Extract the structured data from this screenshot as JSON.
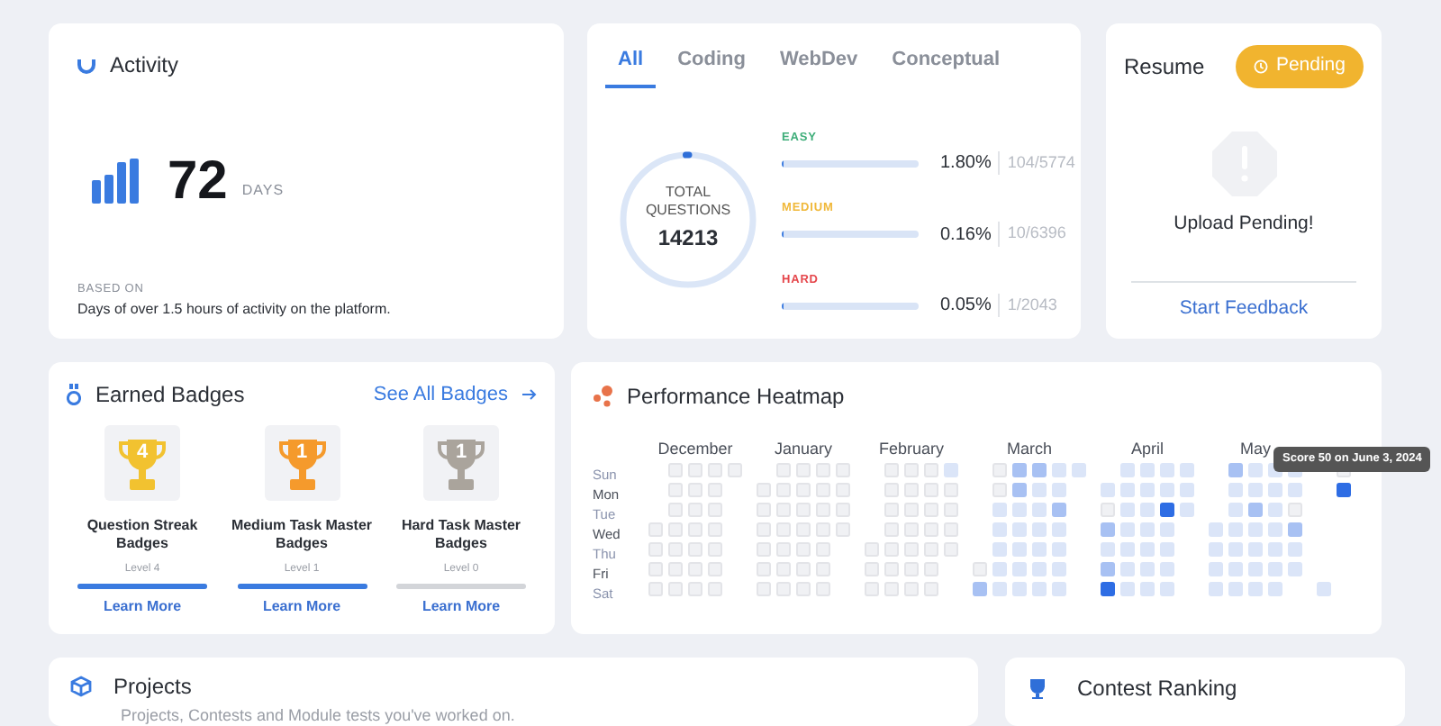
{
  "activity": {
    "title": "Activity",
    "value": "72",
    "unit": "DAYS",
    "note_label": "BASED ON",
    "note": "Days of over 1.5 hours of activity on the platform."
  },
  "questions": {
    "tabs": [
      {
        "label": "All",
        "selected": true
      },
      {
        "label": "Coding",
        "selected": false
      },
      {
        "label": "WebDev",
        "selected": false
      },
      {
        "label": "Conceptual",
        "selected": false
      }
    ],
    "total_label": "TOTAL QUESTIONS",
    "total": "14213",
    "level": 0.008,
    "difficulties": [
      {
        "label": "EASY",
        "color": "#3fae7a",
        "level": 0.018,
        "percent": "1.80%",
        "count": "104/5774"
      },
      {
        "label": "MEDIUM",
        "color": "#f0b83a",
        "level": 0.0016,
        "percent": "0.16%",
        "count": "10/6396"
      },
      {
        "label": "HARD",
        "color": "#e5484d",
        "level": 0.0005,
        "percent": "0.05%",
        "count": "1/2043"
      }
    ]
  },
  "resume": {
    "title": "Resume",
    "status": "Pending",
    "message": "Upload Pending!",
    "link": "Start Feedback"
  },
  "badges": {
    "title": "Earned Badges",
    "link": "See All Badges",
    "items": [
      {
        "number": "4",
        "color": "#f2c230",
        "name": "Question Streak Badges",
        "level_text": "Level 4",
        "level": 1,
        "link": "Learn More"
      },
      {
        "number": "1",
        "color": "#f59a2c",
        "name": "Medium Task Master Badges",
        "level_text": "Level 1",
        "level": 1,
        "link": "Learn More"
      },
      {
        "number": "1",
        "color": "#aaa49c",
        "name": "Hard Task Master Badges",
        "level_text": "Level 0",
        "level": 0,
        "link": "Learn More"
      }
    ]
  },
  "heatmap": {
    "title": "Performance Heatmap",
    "days": [
      "Sun",
      "Mon",
      "Tue",
      "Wed",
      "Thu",
      "Fri",
      "Sat"
    ],
    "tooltip": "Score 50 on June 3, 2024",
    "months": [
      {
        "name": "December",
        "weeks": [
          {
            "wed": {
              "color": "#f0f1f4"
            },
            "thu": {
              "color": "#f0f1f4"
            },
            "fri": {
              "color": "#f0f1f4"
            },
            "sat": {
              "color": "#f0f1f4"
            }
          },
          {
            "sun": {
              "color": "#f0f1f4"
            },
            "mon": {
              "color": "#f0f1f4"
            },
            "tue": {
              "color": "#f0f1f4"
            },
            "wed": {
              "color": "#f0f1f4"
            },
            "thu": {
              "color": "#f0f1f4"
            },
            "fri": {
              "color": "#f0f1f4"
            },
            "sat": {
              "color": "#f0f1f4"
            }
          },
          {
            "sun": {
              "color": "#f0f1f4"
            },
            "mon": {
              "color": "#f0f1f4"
            },
            "tue": {
              "color": "#f0f1f4"
            },
            "wed": {
              "color": "#f0f1f4"
            },
            "thu": {
              "color": "#f0f1f4"
            },
            "fri": {
              "color": "#f0f1f4"
            },
            "sat": {
              "color": "#f0f1f4"
            }
          },
          {
            "sun": {
              "color": "#f0f1f4"
            },
            "mon": {
              "color": "#f0f1f4"
            },
            "tue": {
              "color": "#f0f1f4"
            },
            "wed": {
              "color": "#f0f1f4"
            },
            "thu": {
              "color": "#f0f1f4"
            },
            "fri": {
              "color": "#f0f1f4"
            },
            "sat": {
              "color": "#f0f1f4"
            }
          },
          {
            "sun": {
              "color": "#f0f1f4"
            }
          }
        ]
      },
      {
        "name": "January",
        "weeks": [
          {
            "mon": {
              "color": "#f0f1f4"
            },
            "tue": {
              "color": "#f0f1f4"
            },
            "wed": {
              "color": "#f0f1f4"
            },
            "thu": {
              "color": "#f0f1f4"
            },
            "fri": {
              "color": "#f0f1f4"
            },
            "sat": {
              "color": "#f0f1f4"
            }
          },
          {
            "sun": {
              "color": "#f0f1f4"
            },
            "mon": {
              "color": "#f0f1f4"
            },
            "tue": {
              "color": "#f0f1f4"
            },
            "wed": {
              "color": "#f0f1f4"
            },
            "thu": {
              "color": "#f0f1f4"
            },
            "fri": {
              "color": "#f0f1f4"
            },
            "sat": {
              "color": "#f0f1f4"
            }
          },
          {
            "sun": {
              "color": "#f0f1f4"
            },
            "mon": {
              "color": "#f0f1f4"
            },
            "tue": {
              "color": "#f0f1f4"
            },
            "wed": {
              "color": "#f0f1f4"
            },
            "thu": {
              "color": "#f0f1f4"
            },
            "fri": {
              "color": "#f0f1f4"
            },
            "sat": {
              "color": "#f0f1f4"
            }
          },
          {
            "sun": {
              "color": "#f0f1f4"
            },
            "mon": {
              "color": "#f0f1f4"
            },
            "tue": {
              "color": "#f0f1f4"
            },
            "wed": {
              "color": "#f0f1f4"
            },
            "thu": {
              "color": "#f0f1f4"
            },
            "fri": {
              "color": "#f0f1f4"
            },
            "sat": {
              "color": "#f0f1f4"
            }
          },
          {
            "sun": {
              "color": "#f0f1f4"
            },
            "mon": {
              "color": "#f0f1f4"
            },
            "tue": {
              "color": "#f0f1f4"
            },
            "wed": {
              "color": "#f0f1f4"
            }
          }
        ]
      },
      {
        "name": "February",
        "weeks": [
          {
            "thu": {
              "color": "#f0f1f4"
            },
            "fri": {
              "color": "#f0f1f4"
            },
            "sat": {
              "color": "#f0f1f4"
            }
          },
          {
            "sun": {
              "color": "#f0f1f4"
            },
            "mon": {
              "color": "#f0f1f4"
            },
            "tue": {
              "color": "#f0f1f4"
            },
            "wed": {
              "color": "#f0f1f4"
            },
            "thu": {
              "color": "#f0f1f4"
            },
            "fri": {
              "color": "#f0f1f4"
            },
            "sat": {
              "color": "#f0f1f4"
            }
          },
          {
            "sun": {
              "color": "#f0f1f4"
            },
            "mon": {
              "color": "#f0f1f4"
            },
            "tue": {
              "color": "#f0f1f4"
            },
            "wed": {
              "color": "#f0f1f4"
            },
            "thu": {
              "color": "#f0f1f4"
            },
            "fri": {
              "color": "#f0f1f4"
            },
            "sat": {
              "color": "#f0f1f4"
            }
          },
          {
            "sun": {
              "color": "#f0f1f4"
            },
            "mon": {
              "color": "#f0f1f4"
            },
            "tue": {
              "color": "#f0f1f4"
            },
            "wed": {
              "color": "#f0f1f4"
            },
            "thu": {
              "color": "#f0f1f4"
            },
            "fri": {
              "color": "#f0f1f4"
            },
            "sat": {
              "color": "#f0f1f4"
            }
          },
          {
            "sun": {
              "color": "#dbe5f8"
            },
            "mon": {
              "color": "#f0f1f4"
            },
            "tue": {
              "color": "#f0f1f4"
            },
            "wed": {
              "color": "#f0f1f4"
            },
            "thu": {
              "color": "#f0f1f4"
            }
          }
        ]
      },
      {
        "name": "March",
        "weeks": [
          {
            "fri": {
              "color": "#f0f1f4"
            },
            "sat": {
              "color": "#a8c1f3"
            }
          },
          {
            "sun": {
              "color": "#f0f1f4"
            },
            "mon": {
              "color": "#f0f1f4"
            },
            "tue": {
              "color": "#dbe5f8"
            },
            "wed": {
              "color": "#dbe5f8"
            },
            "thu": {
              "color": "#dbe5f8"
            },
            "fri": {
              "color": "#dbe5f8"
            },
            "sat": {
              "color": "#dbe5f8"
            }
          },
          {
            "sun": {
              "color": "#a8c1f3"
            },
            "mon": {
              "color": "#a8c1f3"
            },
            "tue": {
              "color": "#dbe5f8"
            },
            "wed": {
              "color": "#dbe5f8"
            },
            "thu": {
              "color": "#dbe5f8"
            },
            "fri": {
              "color": "#dbe5f8"
            },
            "sat": {
              "color": "#dbe5f8"
            }
          },
          {
            "sun": {
              "color": "#a8c1f3"
            },
            "mon": {
              "color": "#dbe5f8"
            },
            "tue": {
              "color": "#dbe5f8"
            },
            "wed": {
              "color": "#dbe5f8"
            },
            "thu": {
              "color": "#dbe5f8"
            },
            "fri": {
              "color": "#dbe5f8"
            },
            "sat": {
              "color": "#dbe5f8"
            }
          },
          {
            "sun": {
              "color": "#dbe5f8"
            },
            "mon": {
              "color": "#dbe5f8"
            },
            "tue": {
              "color": "#a8c1f3"
            },
            "wed": {
              "color": "#dbe5f8"
            },
            "thu": {
              "color": "#dbe5f8"
            },
            "fri": {
              "color": "#dbe5f8"
            },
            "sat": {
              "color": "#dbe5f8"
            }
          },
          {
            "sun": {
              "color": "#dbe5f8"
            }
          }
        ]
      },
      {
        "name": "April",
        "weeks": [
          {
            "mon": {
              "color": "#dbe5f8"
            },
            "tue": {
              "color": "#f0f1f4"
            },
            "wed": {
              "color": "#a8c1f3"
            },
            "thu": {
              "color": "#dbe5f8"
            },
            "fri": {
              "color": "#a8c1f3"
            },
            "sat": {
              "color": "#2e6de4"
            }
          },
          {
            "sun": {
              "color": "#dbe5f8"
            },
            "mon": {
              "color": "#dbe5f8"
            },
            "tue": {
              "color": "#dbe5f8"
            },
            "wed": {
              "color": "#dbe5f8"
            },
            "thu": {
              "color": "#dbe5f8"
            },
            "fri": {
              "color": "#dbe5f8"
            },
            "sat": {
              "color": "#dbe5f8"
            }
          },
          {
            "sun": {
              "color": "#dbe5f8"
            },
            "mon": {
              "color": "#dbe5f8"
            },
            "tue": {
              "color": "#dbe5f8"
            },
            "wed": {
              "color": "#dbe5f8"
            },
            "thu": {
              "color": "#dbe5f8"
            },
            "fri": {
              "color": "#dbe5f8"
            },
            "sat": {
              "color": "#dbe5f8"
            }
          },
          {
            "sun": {
              "color": "#dbe5f8"
            },
            "mon": {
              "color": "#dbe5f8"
            },
            "tue": {
              "color": "#2e6de4"
            },
            "wed": {
              "color": "#dbe5f8"
            },
            "thu": {
              "color": "#dbe5f8"
            },
            "fri": {
              "color": "#dbe5f8"
            },
            "sat": {
              "color": "#dbe5f8"
            }
          },
          {
            "sun": {
              "color": "#dbe5f8"
            },
            "mon": {
              "color": "#dbe5f8"
            },
            "tue": {
              "color": "#dbe5f8"
            }
          }
        ]
      },
      {
        "name": "May",
        "weeks": [
          {
            "wed": {
              "color": "#dbe5f8"
            },
            "thu": {
              "color": "#dbe5f8"
            },
            "fri": {
              "color": "#dbe5f8"
            },
            "sat": {
              "color": "#dbe5f8"
            }
          },
          {
            "sun": {
              "color": "#a8c1f3"
            },
            "mon": {
              "color": "#dbe5f8"
            },
            "tue": {
              "color": "#dbe5f8"
            },
            "wed": {
              "color": "#dbe5f8"
            },
            "thu": {
              "color": "#dbe5f8"
            },
            "fri": {
              "color": "#dbe5f8"
            },
            "sat": {
              "color": "#dbe5f8"
            }
          },
          {
            "sun": {
              "color": "#dbe5f8"
            },
            "mon": {
              "color": "#dbe5f8"
            },
            "tue": {
              "color": "#a8c1f3"
            },
            "wed": {
              "color": "#dbe5f8"
            },
            "thu": {
              "color": "#dbe5f8"
            },
            "fri": {
              "color": "#dbe5f8"
            },
            "sat": {
              "color": "#dbe5f8"
            }
          },
          {
            "sun": {
              "color": "#dbe5f8"
            },
            "mon": {
              "color": "#dbe5f8"
            },
            "tue": {
              "color": "#dbe5f8"
            },
            "wed": {
              "color": "#dbe5f8"
            },
            "thu": {
              "color": "#dbe5f8"
            },
            "fri": {
              "color": "#dbe5f8"
            },
            "sat": {
              "color": "#dbe5f8"
            }
          },
          {
            "sun": {
              "color": "#dbe5f8"
            },
            "mon": {
              "color": "#dbe5f8"
            },
            "tue": {
              "color": "#f0f1f4"
            },
            "wed": {
              "color": "#a8c1f3"
            },
            "thu": {
              "color": "#dbe5f8"
            },
            "fri": {
              "color": "#dbe5f8"
            }
          }
        ]
      },
      {
        "weeks": [
          {
            "sat": {
              "color": "#dbe5f8"
            }
          },
          {
            "sun": {
              "color": "#f0f1f4"
            },
            "mon": {
              "color": "#2e6de4"
            }
          }
        ]
      }
    ]
  },
  "projects": {
    "title": "Projects",
    "subtitle": "Projects, Contests and Module tests you've worked on."
  },
  "contest": {
    "title": "Contest Ranking"
  }
}
